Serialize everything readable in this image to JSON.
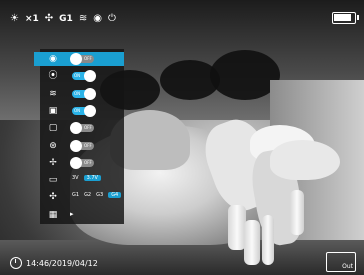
{
  "status_bar": {
    "mode_icon": "sun-icon",
    "zoom": "×1",
    "fan_label": "G1",
    "wifi_icon": "wifi-icon",
    "eye_icon": "eye-icon",
    "power_icon": "power-icon",
    "battery_level": 0.85
  },
  "menu": {
    "items": [
      {
        "icon": "eye-icon",
        "glyph": "◉",
        "control": "toggle",
        "state": "off",
        "label": "OFF",
        "selected": true
      },
      {
        "icon": "record-icon",
        "glyph": "⦿",
        "control": "toggle",
        "state": "on",
        "label": "ON",
        "selected": false
      },
      {
        "icon": "wifi-icon",
        "glyph": "≋",
        "control": "toggle",
        "state": "on",
        "label": "ON",
        "selected": false
      },
      {
        "icon": "pip-icon",
        "glyph": "▣",
        "control": "toggle",
        "state": "on",
        "label": "ON",
        "selected": false
      },
      {
        "icon": "compass-icon",
        "glyph": "▢",
        "control": "toggle",
        "state": "off",
        "label": "OFF",
        "selected": false
      },
      {
        "icon": "lock-icon",
        "glyph": "⊛",
        "control": "toggle",
        "state": "off",
        "label": "OFF",
        "selected": false
      },
      {
        "icon": "fan-icon",
        "glyph": "✢",
        "control": "toggle",
        "state": "off",
        "label": "OFF",
        "selected": false
      },
      {
        "icon": "battery-icon",
        "glyph": "▭",
        "control": "options",
        "options": [
          "3V",
          "3.7V"
        ],
        "selected_option": 1
      },
      {
        "icon": "fan-speed-icon",
        "glyph": "✣",
        "control": "options",
        "options": [
          "G1",
          "G2",
          "G3",
          "G4"
        ],
        "selected_option": 3
      },
      {
        "icon": "grid-icon",
        "glyph": "▦",
        "control": "arrow",
        "arrow": "▸"
      }
    ]
  },
  "timestamp": "14:46/2019/04/12",
  "out_button": {
    "label": "Out"
  }
}
